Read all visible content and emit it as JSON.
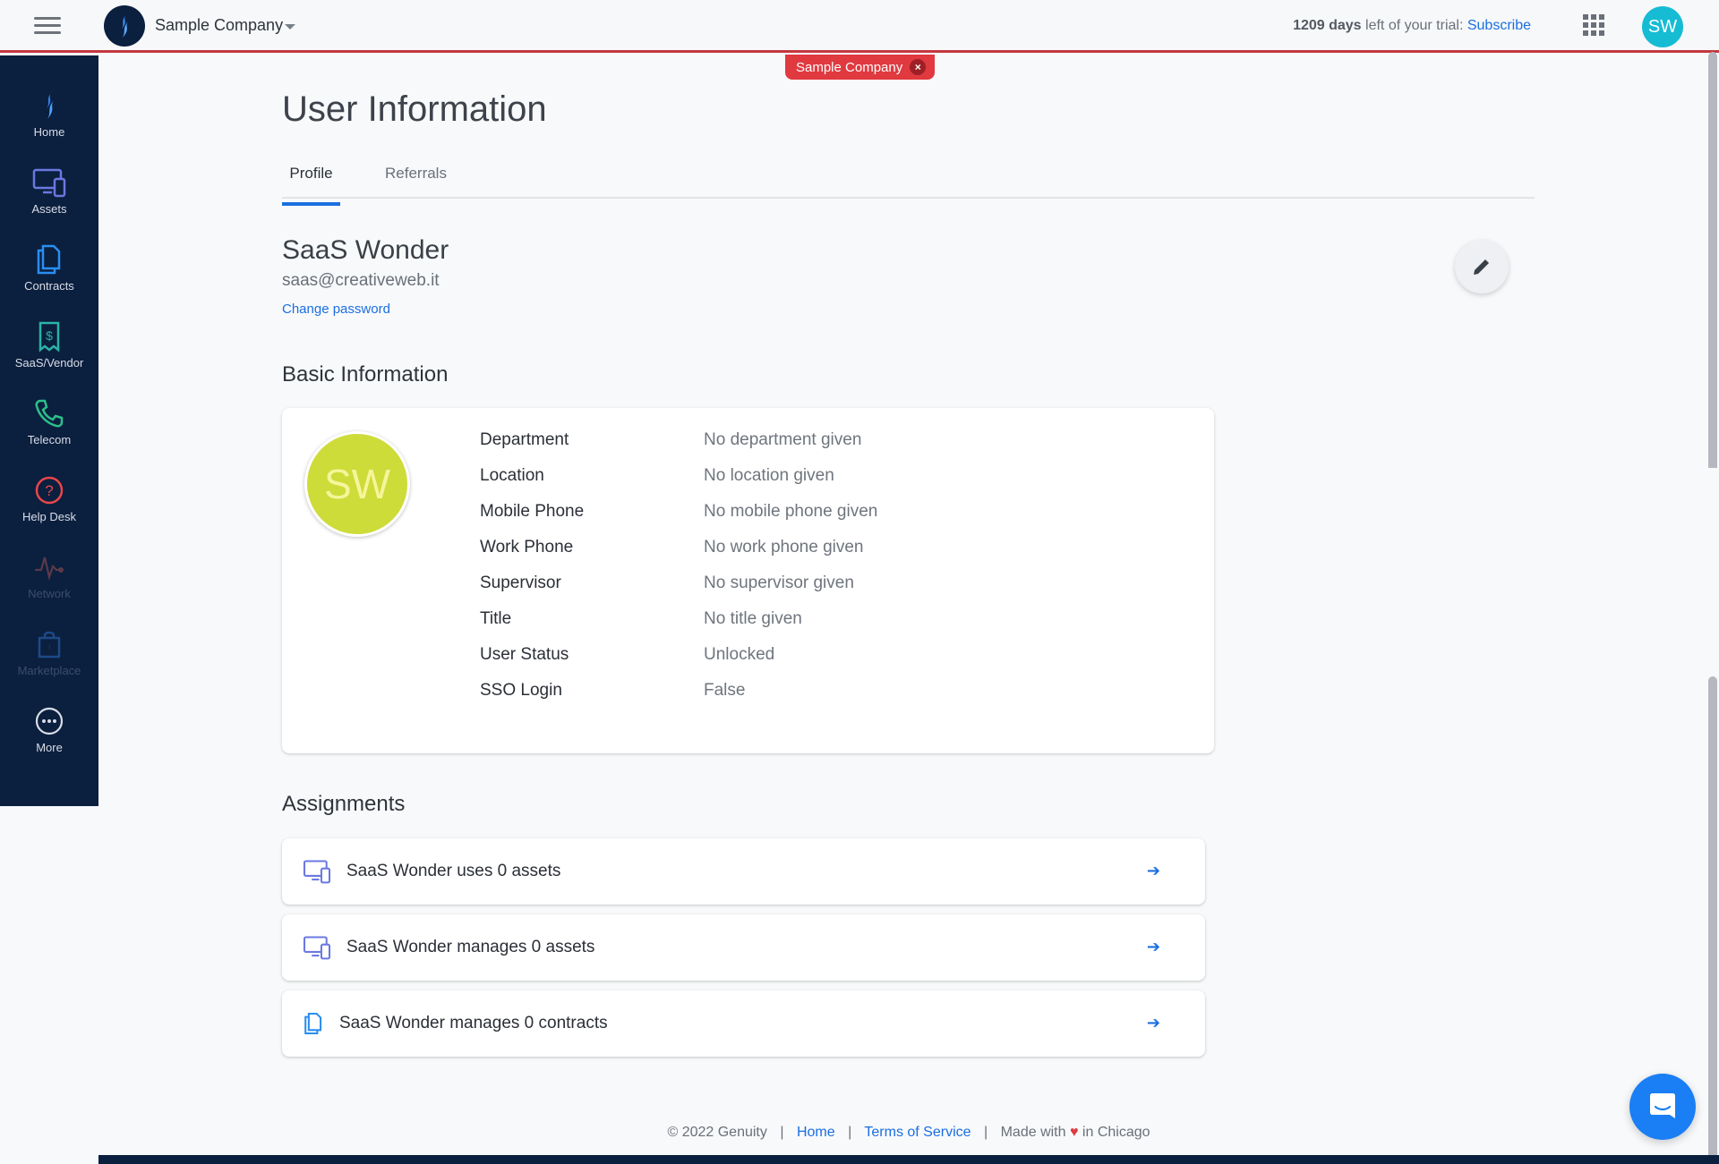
{
  "header": {
    "company_name": "Sample Company",
    "trial_days": "1209 days",
    "trial_text": " left of your trial: ",
    "subscribe_label": "Subscribe",
    "user_initials": "SW",
    "company_chip": "Sample Company",
    "chip_close": "×"
  },
  "sidebar": {
    "items": [
      {
        "label": "Home",
        "icon": "home-flame-icon"
      },
      {
        "label": "Assets",
        "icon": "assets-devices-icon"
      },
      {
        "label": "Contracts",
        "icon": "contracts-documents-icon"
      },
      {
        "label": "SaaS/Vendor",
        "icon": "saas-receipt-icon"
      },
      {
        "label": "Telecom",
        "icon": "telecom-phone-icon"
      },
      {
        "label": "Help Desk",
        "icon": "help-question-icon"
      },
      {
        "label": "Network",
        "icon": "network-pulse-icon",
        "disabled": true
      },
      {
        "label": "Marketplace",
        "icon": "marketplace-bag-icon",
        "disabled": true
      },
      {
        "label": "More",
        "icon": "more-ellipsis-icon"
      }
    ]
  },
  "page": {
    "title": "User Information",
    "tabs": [
      {
        "label": "Profile",
        "active": true
      },
      {
        "label": "Referrals",
        "active": false
      }
    ]
  },
  "profile": {
    "name": "SaaS Wonder",
    "email": "saas@creativeweb.it",
    "change_password_label": "Change password",
    "initials": "SW"
  },
  "basic_info": {
    "title": "Basic Information",
    "rows": [
      {
        "label": "Department",
        "value": "No department given"
      },
      {
        "label": "Location",
        "value": "No location given"
      },
      {
        "label": "Mobile Phone",
        "value": "No mobile phone given"
      },
      {
        "label": "Work Phone",
        "value": "No work phone given"
      },
      {
        "label": "Supervisor",
        "value": "No supervisor given"
      },
      {
        "label": "Title",
        "value": "No title given"
      },
      {
        "label": "User Status",
        "value": "Unlocked"
      },
      {
        "label": "SSO Login",
        "value": "False"
      }
    ]
  },
  "assignments": {
    "title": "Assignments",
    "items": [
      {
        "text": "SaaS Wonder uses 0 assets",
        "icon": "assets-devices-icon"
      },
      {
        "text": "SaaS Wonder manages 0 assets",
        "icon": "assets-devices-icon"
      },
      {
        "text": "SaaS Wonder manages 0 contracts",
        "icon": "contracts-documents-icon"
      }
    ],
    "arrow": "➔"
  },
  "footer": {
    "copyright": "© 2022 Genuity",
    "home_link": "Home",
    "terms_link": "Terms of Service",
    "made_with": "Made with",
    "heart": "♥",
    "in_city": "in Chicago",
    "sep": "|"
  },
  "colors": {
    "sidebar_bg": "#0b1f3f",
    "accent": "#1a6fe0",
    "chip_red": "#e0393f",
    "avatar_lime": "#cddc39",
    "avatar_cyan": "#16bcd4"
  }
}
